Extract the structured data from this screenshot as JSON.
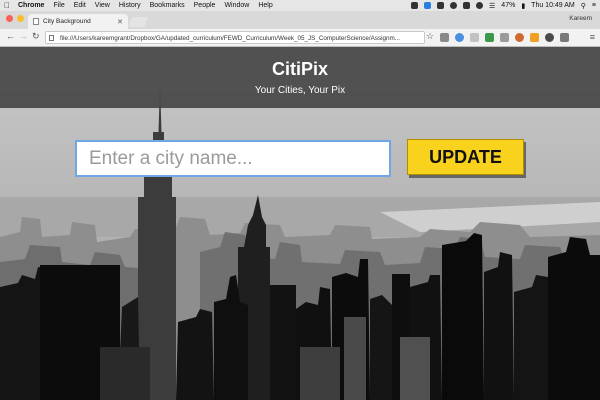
{
  "menubar": {
    "app": "Chrome",
    "items": [
      "File",
      "Edit",
      "View",
      "History",
      "Bookmarks",
      "People",
      "Window",
      "Help"
    ],
    "battery": "47%",
    "clock": "Thu 10:49 AM",
    "icons": [
      "apple-icon",
      "wifi-icon",
      "battery-icon",
      "search-icon",
      "list-icon"
    ]
  },
  "browser": {
    "tab_title": "City Background",
    "profile": "Kareem",
    "url": "file:///Users/kareemgrant/Dropbox/GA/updated_curriculum/FEWD_Curriculum/Week_05_JS_ComputerScience/Assignm..."
  },
  "page": {
    "title": "CitiPix",
    "tagline": "Your Cities, Your Pix",
    "search": {
      "placeholder": "Enter a city name...",
      "value": ""
    },
    "update_label": "UPDATE"
  },
  "colors": {
    "header_bg": "#464646",
    "button_bg": "#f8d21c",
    "input_border": "#6fa7e4"
  }
}
